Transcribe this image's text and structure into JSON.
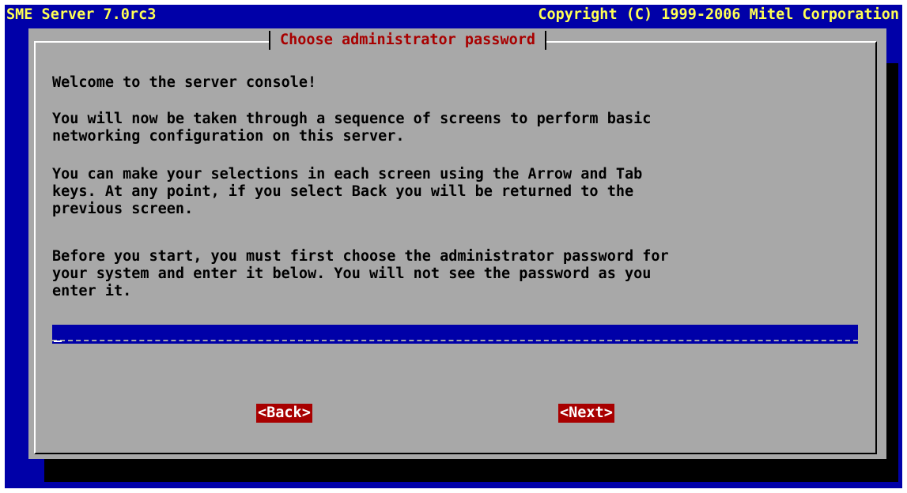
{
  "header": {
    "product": "SME Server 7.0rc3",
    "copyright": "Copyright (C) 1999-2006 Mitel Corporation"
  },
  "dialog": {
    "title": "Choose administrator password",
    "paragraphs": [
      "Welcome to the server console!",
      "You will now be taken through a sequence of screens to perform basic\nnetworking configuration on this server.",
      "You can make your selections in each screen using the Arrow and Tab\nkeys. At any point, if you select Back you will be returned to the\nprevious screen.",
      "Before you start, you must first choose the administrator password for\nyour system and enter it below. You will not see the password as you\nenter it."
    ],
    "password_input": {
      "value": ""
    },
    "buttons": {
      "back": "<Back>",
      "next": "<Next>"
    }
  },
  "colors": {
    "screen_bg": "#0000a8",
    "dialog_bg": "#a8a8a8",
    "title_text": "#a80000",
    "header_text": "#ffff54",
    "button_bg": "#a80000",
    "button_text": "#ffffff"
  }
}
